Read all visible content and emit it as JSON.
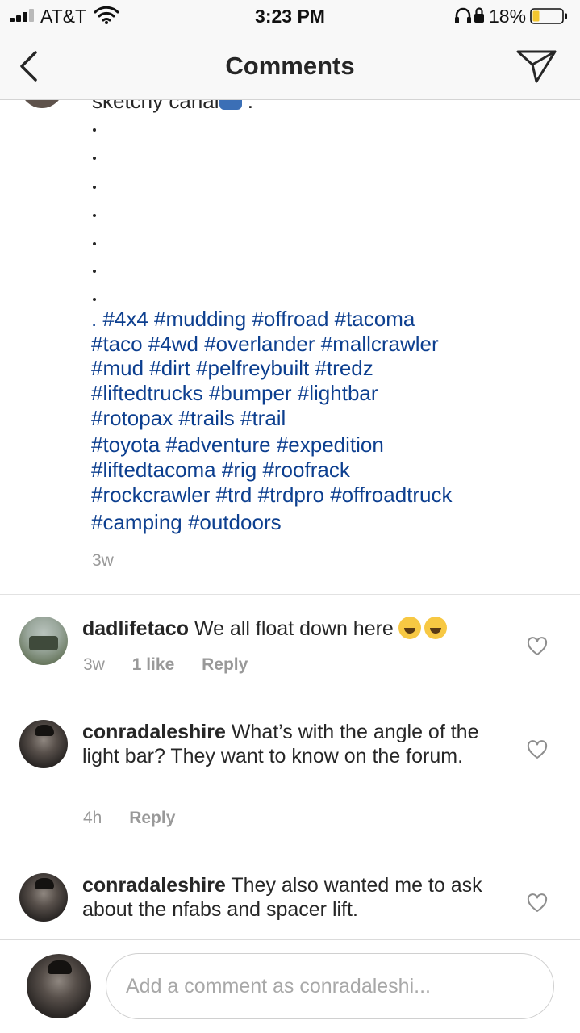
{
  "status_bar": {
    "carrier": "AT&T",
    "time": "3:23 PM",
    "battery": "18%"
  },
  "nav": {
    "title": "Comments"
  },
  "caption": {
    "cut_off_text": "sketchy canal",
    "hashtag_lines": [
      ". #4x4 #mudding #offroad #tacoma",
      "#taco #4wd #overlander #mallcrawler",
      "#mud #dirt #pelfreybuilt #tredz",
      "#liftedtrucks #bumper #lightbar",
      "#rotopax #trails #trail",
      "#toyota #adventure #expedition",
      "#liftedtacoma #rig #roofrack",
      "#rockcrawler #trd #trdpro #offroadtruck",
      "#camping #outdoors"
    ],
    "time": "3w"
  },
  "comments": [
    {
      "username": "dadlifetaco",
      "text": "We all float down here",
      "time": "3w",
      "likes": "1 like",
      "reply_label": "Reply"
    },
    {
      "username": "conradaleshire",
      "text": "What’s with the angle of the light bar? They want to know on the forum.",
      "time": "4h",
      "reply_label": "Reply"
    },
    {
      "username": "conradaleshire",
      "text": "They also wanted me to ask about the nfabs and spacer lift."
    }
  ],
  "input": {
    "placeholder": "Add a comment as conradaleshi..."
  },
  "colors": {
    "hashtag": "#0d3f8f",
    "secondary_text": "#999999",
    "primary_text": "#262626",
    "bar_background": "#f8f8f8"
  }
}
